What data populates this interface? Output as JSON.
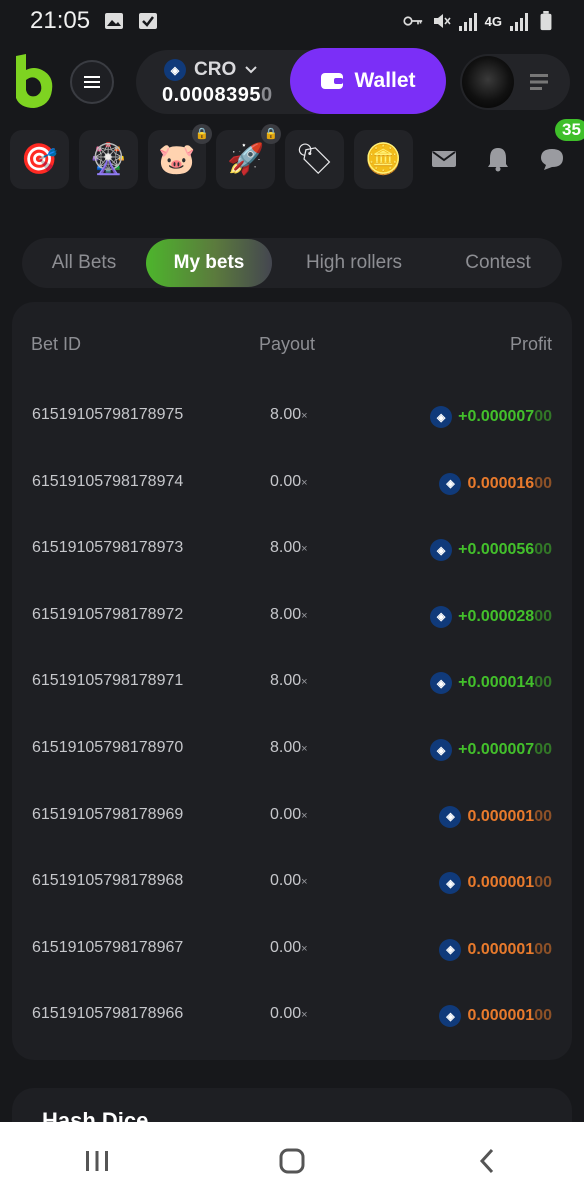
{
  "status_bar": {
    "time": "21:05",
    "network_label": "4G"
  },
  "header": {
    "currency": "CRO",
    "currency_icon": "cro-coin-icon",
    "balance_main": "0.0008395",
    "balance_trailing": "0",
    "wallet_label": "Wallet"
  },
  "games": {
    "tiles": [
      {
        "name": "target-game",
        "icon": "🎯",
        "locked": false
      },
      {
        "name": "wheel-game",
        "icon": "🎡",
        "locked": false
      },
      {
        "name": "piggy-bank",
        "icon": "🐷",
        "locked": true
      },
      {
        "name": "rocket-game",
        "icon": "🚀",
        "locked": true
      },
      {
        "name": "price-tag",
        "icon": "🏷",
        "locked": false
      },
      {
        "name": "coin-drop",
        "icon": "🪙",
        "locked": false
      }
    ],
    "chat_badge": "35"
  },
  "tabs": [
    {
      "label": "All Bets",
      "active": false
    },
    {
      "label": "My bets",
      "active": true
    },
    {
      "label": "High rollers",
      "active": false
    },
    {
      "label": "Contest",
      "active": false
    }
  ],
  "table": {
    "headers": {
      "bet_id": "Bet ID",
      "payout": "Payout",
      "profit": "Profit"
    },
    "payout_suffix": "×",
    "rows": [
      {
        "id": "61519105798178975",
        "payout": "8.00",
        "profit": "+0.000007",
        "profit_tail": "00",
        "status": "win"
      },
      {
        "id": "61519105798178974",
        "payout": "0.00",
        "profit": "0.000016",
        "profit_tail": "00",
        "status": "loss"
      },
      {
        "id": "61519105798178973",
        "payout": "8.00",
        "profit": "+0.000056",
        "profit_tail": "00",
        "status": "win"
      },
      {
        "id": "61519105798178972",
        "payout": "8.00",
        "profit": "+0.000028",
        "profit_tail": "00",
        "status": "win"
      },
      {
        "id": "61519105798178971",
        "payout": "8.00",
        "profit": "+0.000014",
        "profit_tail": "00",
        "status": "win"
      },
      {
        "id": "61519105798178970",
        "payout": "8.00",
        "profit": "+0.000007",
        "profit_tail": "00",
        "status": "win"
      },
      {
        "id": "61519105798178969",
        "payout": "0.00",
        "profit": "0.000001",
        "profit_tail": "00",
        "status": "loss"
      },
      {
        "id": "61519105798178968",
        "payout": "0.00",
        "profit": "0.000001",
        "profit_tail": "00",
        "status": "loss"
      },
      {
        "id": "61519105798178967",
        "payout": "0.00",
        "profit": "0.000001",
        "profit_tail": "00",
        "status": "loss"
      },
      {
        "id": "61519105798178966",
        "payout": "0.00",
        "profit": "0.000001",
        "profit_tail": "00",
        "status": "loss"
      }
    ]
  },
  "hash_section": {
    "title": "Hash Dice"
  },
  "colors": {
    "win": "#43c02b",
    "loss": "#e87a2c",
    "wallet": "#7b2ff7",
    "brand": "#7ed321"
  }
}
